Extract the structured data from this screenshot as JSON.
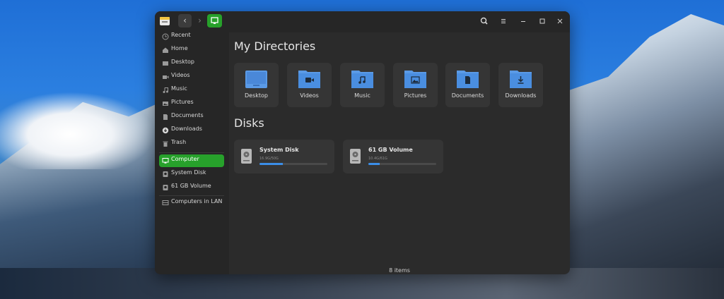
{
  "window": {
    "sidebar": {
      "places": [
        {
          "label": "Recent",
          "icon": "clock-icon"
        },
        {
          "label": "Home",
          "icon": "home-icon"
        },
        {
          "label": "Desktop",
          "icon": "desktop-icon"
        },
        {
          "label": "Videos",
          "icon": "video-icon"
        },
        {
          "label": "Music",
          "icon": "music-icon"
        },
        {
          "label": "Pictures",
          "icon": "image-icon"
        },
        {
          "label": "Documents",
          "icon": "document-icon"
        },
        {
          "label": "Downloads",
          "icon": "download-icon"
        },
        {
          "label": "Trash",
          "icon": "trash-icon"
        }
      ],
      "devices": [
        {
          "label": "Computer",
          "icon": "computer-icon",
          "active": true
        },
        {
          "label": "System Disk",
          "icon": "drive-icon"
        },
        {
          "label": "61 GB Volume",
          "icon": "drive-icon"
        }
      ],
      "network": [
        {
          "label": "Computers in LAN",
          "icon": "network-icon"
        }
      ]
    },
    "main": {
      "directories_title": "My Directories",
      "directories": [
        {
          "label": "Desktop",
          "icon": "folder-desktop-icon"
        },
        {
          "label": "Videos",
          "icon": "folder-video-icon"
        },
        {
          "label": "Music",
          "icon": "folder-music-icon"
        },
        {
          "label": "Pictures",
          "icon": "folder-pictures-icon"
        },
        {
          "label": "Documents",
          "icon": "folder-documents-icon"
        },
        {
          "label": "Downloads",
          "icon": "folder-downloads-icon"
        }
      ],
      "disks_title": "Disks",
      "disks": [
        {
          "name": "System Disk",
          "usage": "16.9G/50G",
          "fill_fraction": 0.34
        },
        {
          "name": "61 GB Volume",
          "usage": "10.4G/61G",
          "fill_fraction": 0.17
        }
      ],
      "status": "8 items"
    },
    "colors": {
      "accent": "#27a12b",
      "folder": "#5a9ae6",
      "progress": "#3b8ee8",
      "window_bg": "#2b2b2b",
      "sidebar_bg": "#262626",
      "tile_bg": "#353535"
    }
  }
}
